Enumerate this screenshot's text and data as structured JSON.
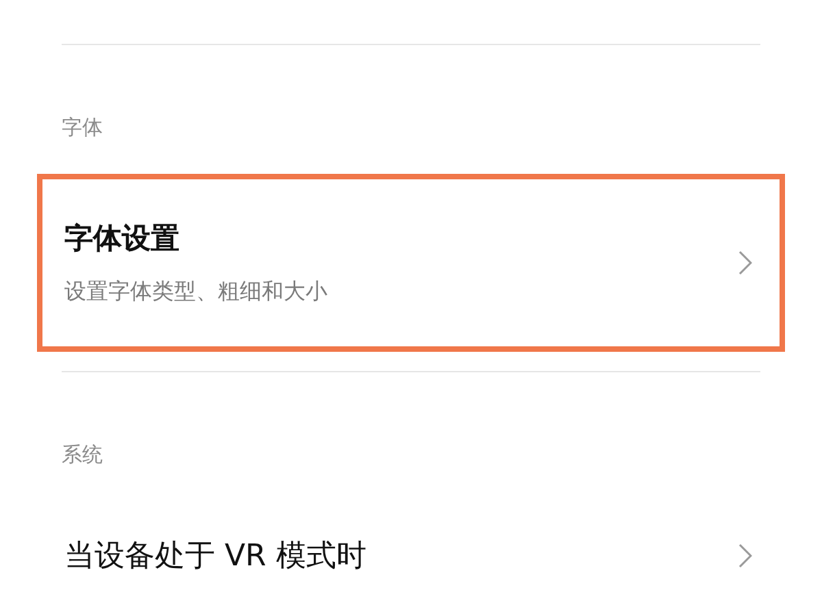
{
  "sections": [
    {
      "header": "字体",
      "items": [
        {
          "title": "字体设置",
          "subtitle": "设置字体类型、粗细和大小",
          "highlighted": true
        }
      ]
    },
    {
      "header": "系统",
      "items": [
        {
          "title": "当设备处于 VR 模式时",
          "highlighted": false
        }
      ]
    }
  ]
}
